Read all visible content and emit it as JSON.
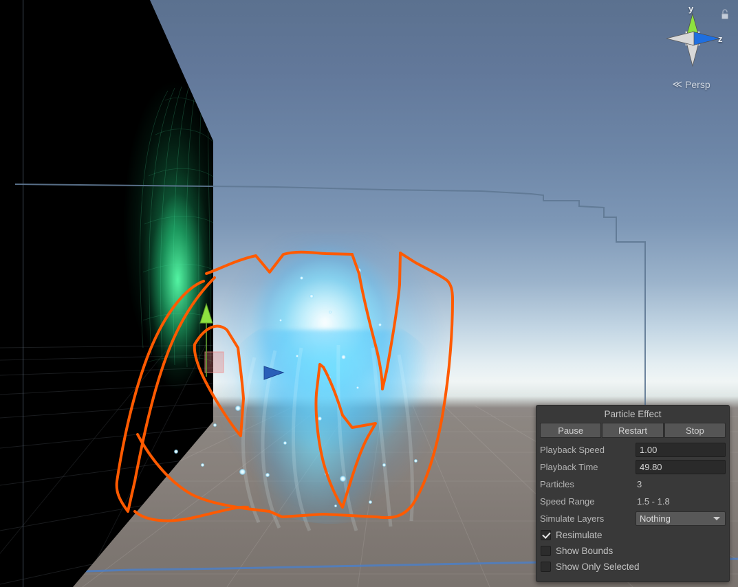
{
  "view_gizmo": {
    "axis_y": "y",
    "axis_z": "z",
    "projection_label": "Persp",
    "projection_prefix": "≪",
    "lock_icon": "unlocked-padlock-icon",
    "colors": {
      "y_axis": "#7ed321",
      "z_axis": "#1f6fe0",
      "neutral_axis": "#d8d8d8"
    }
  },
  "scene": {
    "gizmo_tool": "move-tool",
    "gizmo_axes": {
      "up": "y-axis-arrow",
      "right": "z-axis-arrow",
      "plane": "xy-plane-handle"
    },
    "annotation_color": "#ff5a00",
    "particle_glow_color": "#8fe8ff",
    "wall_glow_color": "#36d98c",
    "outline_color": "#5f7894",
    "ground_line_color": "#4d7fc4"
  },
  "panel": {
    "title": "Particle Effect",
    "buttons": [
      {
        "label": "Pause",
        "name": "pause-button"
      },
      {
        "label": "Restart",
        "name": "restart-button"
      },
      {
        "label": "Stop",
        "name": "stop-button"
      }
    ],
    "fields": [
      {
        "label": "Playback Speed",
        "value": "1.00",
        "type": "input"
      },
      {
        "label": "Playback Time",
        "value": "49.80",
        "type": "input"
      },
      {
        "label": "Particles",
        "value": "3",
        "type": "static"
      },
      {
        "label": "Speed Range",
        "value": "1.5 - 1.8",
        "type": "static"
      },
      {
        "label": "Simulate Layers",
        "value": "Nothing",
        "type": "dropdown"
      }
    ],
    "checkboxes": [
      {
        "label": "Resimulate",
        "checked": true
      },
      {
        "label": "Show Bounds",
        "checked": false
      },
      {
        "label": "Show Only Selected",
        "checked": false
      }
    ]
  }
}
